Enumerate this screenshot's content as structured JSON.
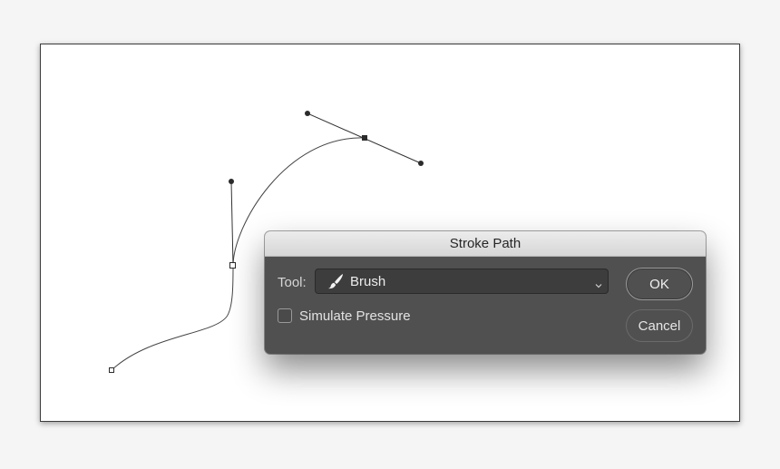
{
  "canvas": {
    "path_color": "#333333"
  },
  "dialog": {
    "title": "Stroke Path",
    "tool_label": "Tool:",
    "tool_value": "Brush",
    "tool_icon": "brush-icon",
    "simulate_pressure_label": "Simulate Pressure",
    "simulate_pressure_checked": false,
    "ok_label": "OK",
    "cancel_label": "Cancel",
    "colors": {
      "body": "#505050",
      "titlebar": "#dcdcdc",
      "select": "#3d3d3d"
    }
  }
}
